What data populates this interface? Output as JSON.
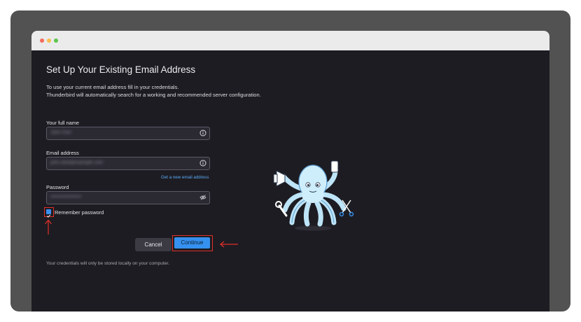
{
  "window": {
    "controls": [
      "close-icon",
      "minimize-icon",
      "maximize-icon"
    ]
  },
  "setup": {
    "heading": "Set Up Your Existing Email Address",
    "intro_line1": "To use your current email address fill in your credentials.",
    "intro_line2": "Thunderbird will automatically search for a working and recommended server configuration.",
    "full_name_label": "Your full name",
    "full_name_value": "John Doe",
    "email_label": "Email address",
    "email_value": "john.doe@example.com",
    "get_new_email_link": "Get a new email address",
    "password_label": "Password",
    "password_value": "••••••••••••••••••",
    "remember_label": "Remember password",
    "remember_checked": true,
    "cancel_label": "Cancel",
    "continue_label": "Continue",
    "footer_note": "Your credentials will only be stored locally on your computer."
  },
  "icons": {
    "full_name_icon": "info-icon",
    "email_icon": "info-icon",
    "password_icon": "eye-slash-icon",
    "mascot": "octopus-mascot-icon"
  },
  "colors": {
    "accent": "#3591f0",
    "annotation": "#e0302a",
    "link": "#5aaaf5",
    "background": "#1d1c22"
  }
}
